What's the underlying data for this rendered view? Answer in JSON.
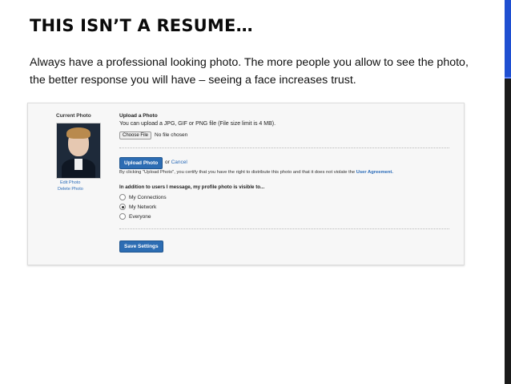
{
  "slide": {
    "title": "THIS ISN’T A RESUME…",
    "body": "Always have a professional looking photo. The more people you allow to see the photo, the better response you will have – seeing a face increases trust."
  },
  "panel": {
    "current_photo_label": "Current Photo",
    "edit_photo_link": "Edit Photo",
    "delete_photo_link": "Delete Photo",
    "upload_title": "Upload a Photo",
    "upload_desc": "You can upload a JPG, GIF or PNG file (File size limit is 4 MB).",
    "choose_file_label": "Choose File",
    "no_file_text": "No file chosen",
    "upload_button": "Upload Photo",
    "or_text": "or",
    "cancel_link": "Cancel",
    "agreement_text": "By clicking \"Upload Photo\", you certify that you have the right to distribute this photo and that it does not violate the",
    "agreement_link": "User Agreement.",
    "visibility_label": "In addition to users I message, my profile photo is visible to...",
    "visibility_options": [
      {
        "label": "My Connections",
        "checked": false
      },
      {
        "label": "My Network",
        "checked": true
      },
      {
        "label": "Everyone",
        "checked": false
      }
    ],
    "save_button": "Save Settings"
  },
  "colors": {
    "accent_blue": "#2d6db3",
    "side_bar_blue": "#1f4fd1"
  }
}
